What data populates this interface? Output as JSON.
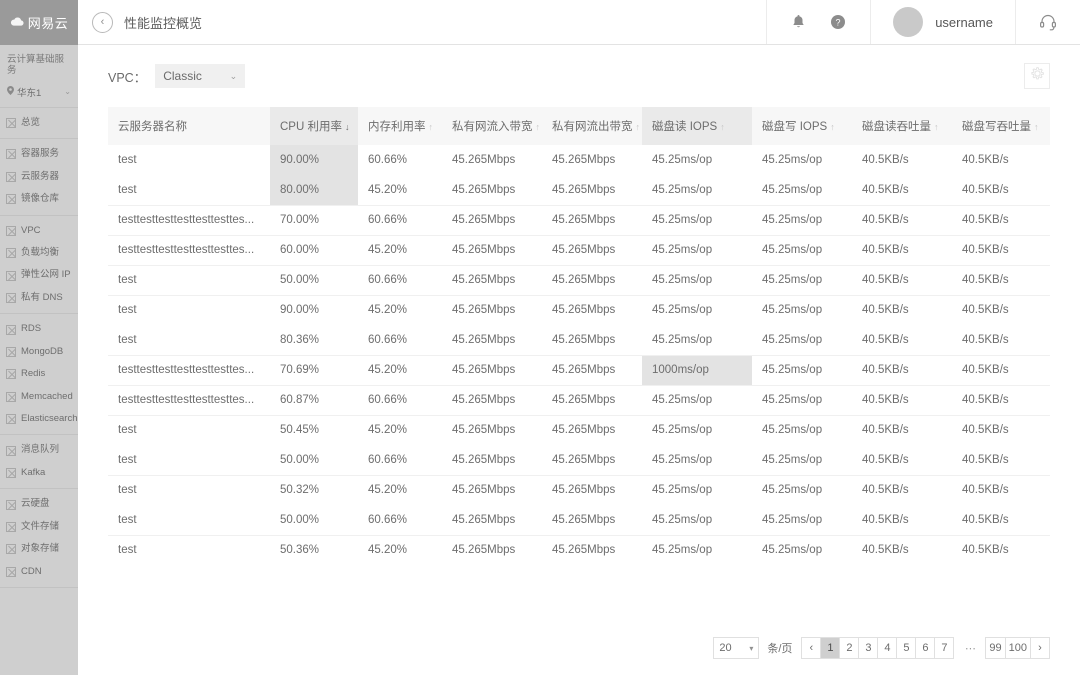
{
  "topbar": {
    "logo_mark": "☁",
    "logo_text": "网易云",
    "back_icon": "‹",
    "title": "性能监控概览",
    "bell_icon": "bell-icon",
    "help_icon": "?",
    "username": "username",
    "support_icon": "headset-icon"
  },
  "sidebar": {
    "section_title": "云计算基础服务",
    "region": "华东1",
    "groups": [
      {
        "items": [
          "总览"
        ]
      },
      {
        "items": [
          "容器服务",
          "云服务器",
          "镜像仓库"
        ]
      },
      {
        "items": [
          "VPC",
          "负载均衡",
          "弹性公网 IP",
          "私有 DNS"
        ]
      },
      {
        "items": [
          "RDS",
          "MongoDB",
          "Redis",
          "Memcached",
          "Elasticsearch"
        ]
      },
      {
        "items": [
          "消息队列",
          "Kafka"
        ]
      },
      {
        "items": [
          "云硬盘",
          "文件存储",
          "对象存储",
          "CDN"
        ]
      }
    ]
  },
  "filter": {
    "vpc_label": "VPC：",
    "vpc_value": "Classic",
    "chevron": "⌄",
    "gear_icon": "gear-icon"
  },
  "table": {
    "columns": [
      {
        "label": "云服务器名称",
        "sortable": false,
        "highlight": false
      },
      {
        "label": "CPU 利用率",
        "sortable": true,
        "sort": "desc",
        "highlight": true
      },
      {
        "label": "内存利用率",
        "sortable": true,
        "sort": "none",
        "highlight": false
      },
      {
        "label": "私有网流入带宽",
        "sortable": true,
        "sort": "none",
        "highlight": false
      },
      {
        "label": "私有网流出带宽",
        "sortable": true,
        "sort": "none",
        "highlight": false
      },
      {
        "label": "磁盘读 IOPS",
        "sortable": true,
        "sort": "none",
        "highlight": true
      },
      {
        "label": "磁盘写 IOPS",
        "sortable": true,
        "sort": "none",
        "highlight": false
      },
      {
        "label": "磁盘读吞吐量",
        "sortable": true,
        "sort": "none",
        "highlight": false
      },
      {
        "label": "磁盘写吞吐量",
        "sortable": true,
        "sort": "none",
        "highlight": false
      }
    ],
    "sort_desc_glyph": "↓",
    "sort_none_glyph": "↑",
    "rows": [
      {
        "name": "test",
        "cpu": "90.00%",
        "mem": "60.66%",
        "net_in": "45.265Mbps",
        "net_out": "45.265Mbps",
        "read_iops": "45.25ms/op",
        "write_iops": "45.25ms/op",
        "read_tp": "40.5KB/s",
        "write_tp": "40.5KB/s",
        "cpu_hl": true,
        "iops_hl": false,
        "sep": false
      },
      {
        "name": "test",
        "cpu": "80.00%",
        "mem": "45.20%",
        "net_in": "45.265Mbps",
        "net_out": "45.265Mbps",
        "read_iops": "45.25ms/op",
        "write_iops": "45.25ms/op",
        "read_tp": "40.5KB/s",
        "write_tp": "40.5KB/s",
        "cpu_hl": true,
        "iops_hl": false,
        "sep": false
      },
      {
        "name": "testtesttesttesttesttesttes...",
        "cpu": "70.00%",
        "mem": "60.66%",
        "net_in": "45.265Mbps",
        "net_out": "45.265Mbps",
        "read_iops": "45.25ms/op",
        "write_iops": "45.25ms/op",
        "read_tp": "40.5KB/s",
        "write_tp": "40.5KB/s",
        "cpu_hl": false,
        "iops_hl": false,
        "sep": true
      },
      {
        "name": "testtesttesttesttesttesttes...",
        "cpu": "60.00%",
        "mem": "45.20%",
        "net_in": "45.265Mbps",
        "net_out": "45.265Mbps",
        "read_iops": "45.25ms/op",
        "write_iops": "45.25ms/op",
        "read_tp": "40.5KB/s",
        "write_tp": "40.5KB/s",
        "cpu_hl": false,
        "iops_hl": false,
        "sep": true
      },
      {
        "name": "test",
        "cpu": "50.00%",
        "mem": "60.66%",
        "net_in": "45.265Mbps",
        "net_out": "45.265Mbps",
        "read_iops": "45.25ms/op",
        "write_iops": "45.25ms/op",
        "read_tp": "40.5KB/s",
        "write_tp": "40.5KB/s",
        "cpu_hl": false,
        "iops_hl": false,
        "sep": true
      },
      {
        "name": "test",
        "cpu": "90.00%",
        "mem": "45.20%",
        "net_in": "45.265Mbps",
        "net_out": "45.265Mbps",
        "read_iops": "45.25ms/op",
        "write_iops": "45.25ms/op",
        "read_tp": "40.5KB/s",
        "write_tp": "40.5KB/s",
        "cpu_hl": false,
        "iops_hl": false,
        "sep": true
      },
      {
        "name": "test",
        "cpu": "80.36%",
        "mem": "60.66%",
        "net_in": "45.265Mbps",
        "net_out": "45.265Mbps",
        "read_iops": "45.25ms/op",
        "write_iops": "45.25ms/op",
        "read_tp": "40.5KB/s",
        "write_tp": "40.5KB/s",
        "cpu_hl": false,
        "iops_hl": false,
        "sep": false
      },
      {
        "name": "testtesttesttesttesttesttes...",
        "cpu": "70.69%",
        "mem": "45.20%",
        "net_in": "45.265Mbps",
        "net_out": "45.265Mbps",
        "read_iops": "1000ms/op",
        "write_iops": "45.25ms/op",
        "read_tp": "40.5KB/s",
        "write_tp": "40.5KB/s",
        "cpu_hl": false,
        "iops_hl": true,
        "sep": true
      },
      {
        "name": "testtesttesttesttesttesttes...",
        "cpu": "60.87%",
        "mem": "60.66%",
        "net_in": "45.265Mbps",
        "net_out": "45.265Mbps",
        "read_iops": "45.25ms/op",
        "write_iops": "45.25ms/op",
        "read_tp": "40.5KB/s",
        "write_tp": "40.5KB/s",
        "cpu_hl": false,
        "iops_hl": false,
        "sep": true
      },
      {
        "name": "test",
        "cpu": "50.45%",
        "mem": "45.20%",
        "net_in": "45.265Mbps",
        "net_out": "45.265Mbps",
        "read_iops": "45.25ms/op",
        "write_iops": "45.25ms/op",
        "read_tp": "40.5KB/s",
        "write_tp": "40.5KB/s",
        "cpu_hl": false,
        "iops_hl": false,
        "sep": true
      },
      {
        "name": "test",
        "cpu": "50.00%",
        "mem": "60.66%",
        "net_in": "45.265Mbps",
        "net_out": "45.265Mbps",
        "read_iops": "45.25ms/op",
        "write_iops": "45.25ms/op",
        "read_tp": "40.5KB/s",
        "write_tp": "40.5KB/s",
        "cpu_hl": false,
        "iops_hl": false,
        "sep": false
      },
      {
        "name": "test",
        "cpu": "50.32%",
        "mem": "45.20%",
        "net_in": "45.265Mbps",
        "net_out": "45.265Mbps",
        "read_iops": "45.25ms/op",
        "write_iops": "45.25ms/op",
        "read_tp": "40.5KB/s",
        "write_tp": "40.5KB/s",
        "cpu_hl": false,
        "iops_hl": false,
        "sep": true
      },
      {
        "name": "test",
        "cpu": "50.00%",
        "mem": "60.66%",
        "net_in": "45.265Mbps",
        "net_out": "45.265Mbps",
        "read_iops": "45.25ms/op",
        "write_iops": "45.25ms/op",
        "read_tp": "40.5KB/s",
        "write_tp": "40.5KB/s",
        "cpu_hl": false,
        "iops_hl": false,
        "sep": false
      },
      {
        "name": "test",
        "cpu": "50.36%",
        "mem": "45.20%",
        "net_in": "45.265Mbps",
        "net_out": "45.265Mbps",
        "read_iops": "45.25ms/op",
        "write_iops": "45.25ms/op",
        "read_tp": "40.5KB/s",
        "write_tp": "40.5KB/s",
        "cpu_hl": false,
        "iops_hl": false,
        "sep": true
      }
    ]
  },
  "pagination": {
    "page_size": "20",
    "caret": "▾",
    "per_page_label": "条/页",
    "prev": "‹",
    "next": "›",
    "pages": [
      "1",
      "2",
      "3",
      "4",
      "5",
      "6",
      "7"
    ],
    "ellipsis": "⋯",
    "tail_pages": [
      "99",
      "100"
    ],
    "current": "1"
  }
}
